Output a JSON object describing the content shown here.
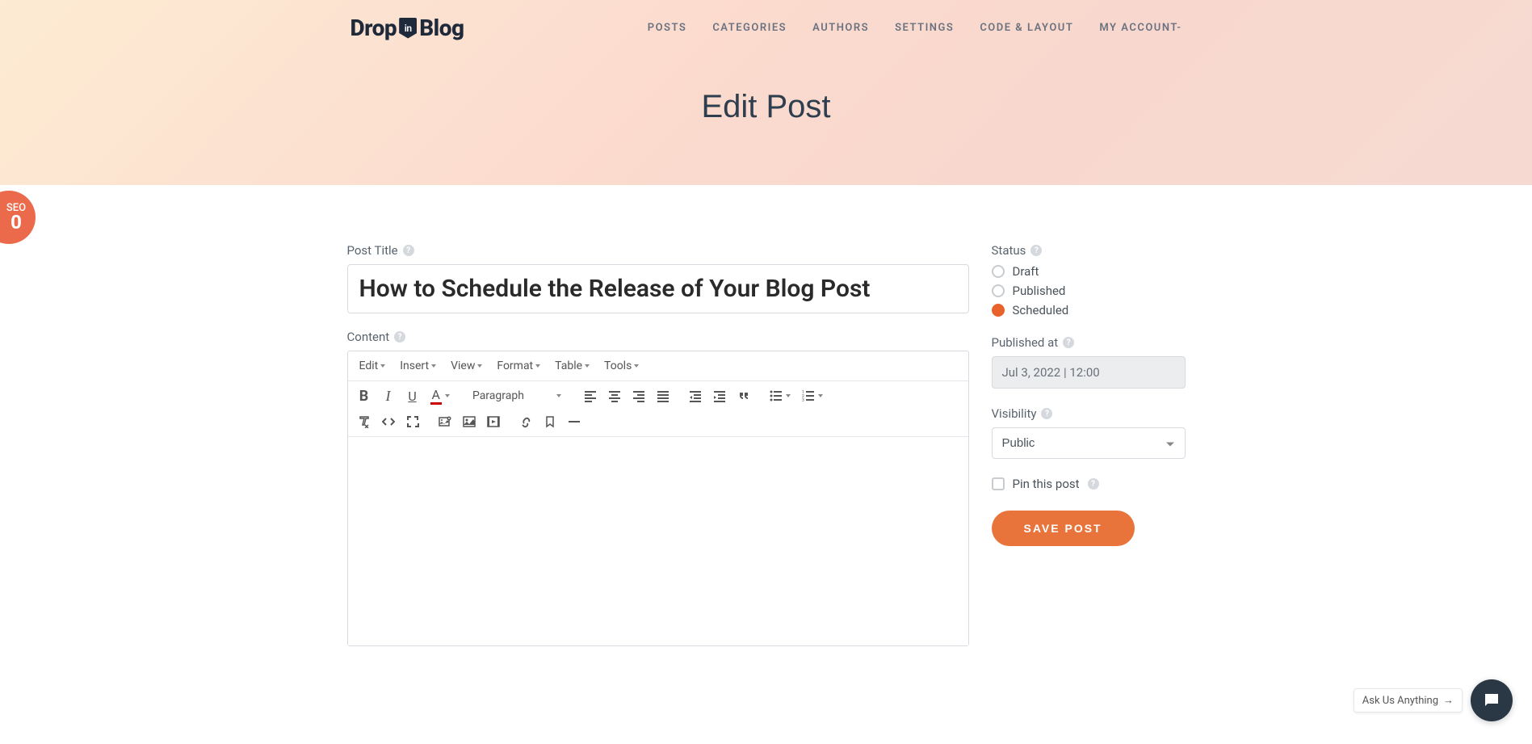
{
  "logo": {
    "part1": "Drop",
    "shield": "in",
    "part2": "Blog"
  },
  "nav": {
    "posts": "POSTS",
    "categories": "CATEGORIES",
    "authors": "AUTHORS",
    "settings": "SETTINGS",
    "code": "CODE & LAYOUT",
    "account": "MY ACCOUNT-"
  },
  "page_title": "Edit Post",
  "seo": {
    "label": "SEO",
    "score": "0"
  },
  "labels": {
    "post_title": "Post Title",
    "content": "Content",
    "status": "Status",
    "published_at": "Published at",
    "visibility": "Visibility",
    "pin": "Pin this post"
  },
  "title_value": "How to Schedule the Release of Your Blog Post",
  "editor_menus": {
    "edit": "Edit",
    "insert": "Insert",
    "view": "View",
    "format": "Format",
    "table": "Table",
    "tools": "Tools"
  },
  "editor_paragraph": "Paragraph",
  "status_options": {
    "draft": "Draft",
    "published": "Published",
    "scheduled": "Scheduled"
  },
  "status_selected": "scheduled",
  "published_at_value": "Jul 3, 2022 | 12:00",
  "visibility_value": "Public",
  "save_button": "SAVE POST",
  "chat": {
    "text": "Ask Us Anything",
    "arrow": "→"
  }
}
